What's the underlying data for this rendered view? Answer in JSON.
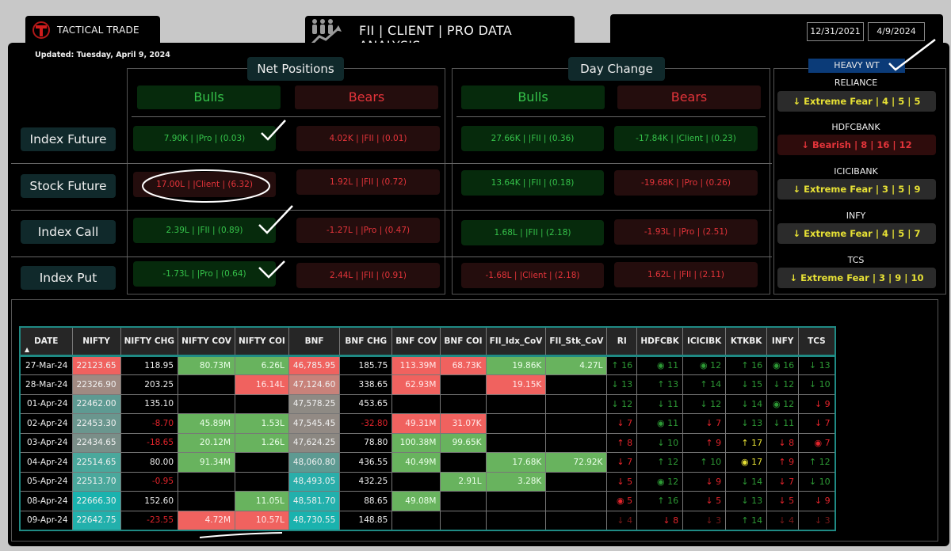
{
  "app": {
    "brand": "TACTICAL TRADE",
    "title": "FII | CLIENT | PRO DATA ANALYSIS",
    "updated": "Updated: Tuesday, April 9, 2024",
    "date_range": {
      "start": "12/31/2021",
      "end": "4/9/2024"
    }
  },
  "net_positions": {
    "title": "Net Positions",
    "bulls_label": "Bulls",
    "bears_label": "Bears",
    "rows": [
      {
        "label": "Index Future",
        "bull": "7.90K | |Pro | (0.03)",
        "bear": "4.02K | |FII | (0.01)",
        "bull_tone": "green",
        "bear_tone": "red"
      },
      {
        "label": "Stock Future",
        "bull": "17.00L | |Client | (6.32)",
        "bear": "1.92L | |FII | (0.72)",
        "bull_tone": "red",
        "bear_tone": "red"
      },
      {
        "label": "Index Call",
        "bull": "2.39L | |FII | (0.89)",
        "bear": "-1.27L | |Pro | (0.47)",
        "bull_tone": "green",
        "bear_tone": "red"
      },
      {
        "label": "Index Put",
        "bull": "-1.73L | |Pro | (0.64)",
        "bear": "2.44L | |FII | (0.91)",
        "bull_tone": "green",
        "bear_tone": "red"
      }
    ]
  },
  "day_change": {
    "title": "Day Change",
    "bulls_label": "Bulls",
    "bears_label": "Bears",
    "rows": [
      {
        "bull": "27.66K | |FII | (0.36)",
        "bear": "-17.84K | |Client | (0.23)",
        "bull_tone": "green",
        "bear_tone": "green"
      },
      {
        "bull": "13.64K | |FII | (0.18)",
        "bear": "-19.68K | |Pro | (0.26)",
        "bull_tone": "green",
        "bear_tone": "red"
      },
      {
        "bull": "1.68L | |FII | (2.18)",
        "bear": "-1.93L | |Pro | (2.51)",
        "bull_tone": "green",
        "bear_tone": "red"
      },
      {
        "bull": "-1.68L | |Client | (2.18)",
        "bear": "1.62L | |FII | (2.11)",
        "bull_tone": "red",
        "bear_tone": "red"
      }
    ]
  },
  "heavy_wt": {
    "title": "HEAVY WT",
    "items": [
      {
        "name": "RELIANCE",
        "value": "↓ Extreme Fear | 4 | 5 | 5",
        "tone": "fear"
      },
      {
        "name": "HDFCBANK",
        "value": "↓ Bearish | 8 | 16 | 12",
        "tone": "bear"
      },
      {
        "name": "ICICIBANK",
        "value": "↓ Extreme Fear | 3 | 5 | 9",
        "tone": "fear"
      },
      {
        "name": "INFY",
        "value": "↓ Extreme Fear | 4 | 5 | 7",
        "tone": "fear"
      },
      {
        "name": "TCS",
        "value": "↓ Extreme Fear | 3 | 9 | 10",
        "tone": "fear"
      }
    ]
  },
  "table": {
    "sort_indicator": "▲",
    "columns": [
      "DATE",
      "NIFTY",
      "NIFTY CHG",
      "NIFTY COV",
      "NIFTY COI",
      "BNF",
      "BNF CHG",
      "BNF COV",
      "BNF COI",
      "FII_Idx_CoV",
      "FII_Stk_CoV",
      "RI",
      "HDFCBK",
      "ICICIBK",
      "KTKBK",
      "INFY",
      "TCS"
    ],
    "rows": [
      {
        "date": "27-Mar-24",
        "nifty": "22123.65",
        "nifty_bg": "#f0625f",
        "nifty_chg": "118.95",
        "nifty_cov": "80.73M",
        "nifty_cov_t": "g",
        "nifty_coi": "6.26L",
        "nifty_coi_t": "g",
        "bnf": "46,785.95",
        "bnf_bg": "#f0625f",
        "bnf_chg": "185.75",
        "bnf_cov": "113.39M",
        "bnf_cov_t": "r",
        "bnf_coi": "68.73K",
        "bnf_coi_t": "r",
        "fii_idx": "19.86K",
        "fii_idx_t": "g",
        "fii_stk": "4.27L",
        "fii_stk_t": "g",
        "signals": [
          [
            "↑ 16",
            "g"
          ],
          [
            "◉ 11",
            "g"
          ],
          [
            "◉ 12",
            "g"
          ],
          [
            "↑ 16",
            "g"
          ],
          [
            "◉ 16",
            "g"
          ],
          [
            "↓ 13",
            "g"
          ]
        ]
      },
      {
        "date": "28-Mar-24",
        "nifty": "22326.90",
        "nifty_bg": "#a08a82",
        "nifty_chg": "203.25",
        "nifty_cov": "",
        "nifty_cov_t": "",
        "nifty_coi": "16.14L",
        "nifty_coi_t": "r",
        "bnf": "47,124.60",
        "bnf_bg": "#c8827a",
        "bnf_chg": "338.65",
        "bnf_cov": "62.93M",
        "bnf_cov_t": "r",
        "bnf_coi": "",
        "bnf_coi_t": "",
        "fii_idx": "19.15K",
        "fii_idx_t": "r",
        "fii_stk": "",
        "fii_stk_t": "",
        "signals": [
          [
            "↓ 13",
            "g"
          ],
          [
            "↑ 13",
            "g"
          ],
          [
            "↑ 14",
            "g"
          ],
          [
            "↓ 15",
            "g"
          ],
          [
            "↓ 12",
            "g"
          ],
          [
            "↓ 10",
            "g"
          ]
        ]
      },
      {
        "date": "01-Apr-24",
        "nifty": "22462.00",
        "nifty_bg": "#5e9a92",
        "nifty_chg": "135.10",
        "nifty_cov": "",
        "nifty_cov_t": "",
        "nifty_coi": "",
        "nifty_coi_t": "",
        "bnf": "47,578.25",
        "bnf_bg": "#8e8a84",
        "bnf_chg": "453.65",
        "bnf_cov": "",
        "bnf_cov_t": "",
        "bnf_coi": "",
        "bnf_coi_t": "",
        "fii_idx": "",
        "fii_idx_t": "",
        "fii_stk": "",
        "fii_stk_t": "",
        "signals": [
          [
            "↓ 12",
            "g"
          ],
          [
            "↓ 11",
            "g"
          ],
          [
            "↓ 12",
            "g"
          ],
          [
            "↓ 14",
            "g"
          ],
          [
            "◉ 12",
            "g"
          ],
          [
            "↓ 9",
            "r"
          ]
        ]
      },
      {
        "date": "02-Apr-24",
        "nifty": "22453.30",
        "nifty_bg": "#6a968e",
        "nifty_chg": "-8.70",
        "nifty_cov": "45.89M",
        "nifty_cov_t": "g",
        "nifty_coi": "1.53L",
        "nifty_coi_t": "g",
        "bnf": "47,545.45",
        "bnf_bg": "#928a84",
        "bnf_chg": "-32.80",
        "bnf_cov": "49.31M",
        "bnf_cov_t": "r",
        "bnf_coi": "31.07K",
        "bnf_coi_t": "r",
        "fii_idx": "",
        "fii_idx_t": "",
        "fii_stk": "",
        "fii_stk_t": "",
        "signals": [
          [
            "↓ 7",
            "r"
          ],
          [
            "◉ 11",
            "g"
          ],
          [
            "↓ 7",
            "r"
          ],
          [
            "↓ 13",
            "g"
          ],
          [
            "↓ 11",
            "g"
          ],
          [
            "↓ 7",
            "r"
          ]
        ]
      },
      {
        "date": "03-Apr-24",
        "nifty": "22434.65",
        "nifty_bg": "#7a8e88",
        "nifty_chg": "-18.65",
        "nifty_cov": "20.12M",
        "nifty_cov_t": "g",
        "nifty_coi": "1.26L",
        "nifty_coi_t": "g",
        "bnf": "47,624.25",
        "bnf_bg": "#8c8882",
        "bnf_chg": "78.80",
        "bnf_cov": "100.38M",
        "bnf_cov_t": "g",
        "bnf_coi": "99.65K",
        "bnf_coi_t": "g",
        "fii_idx": "",
        "fii_idx_t": "",
        "fii_stk": "",
        "fii_stk_t": "",
        "signals": [
          [
            "↑ 8",
            "r"
          ],
          [
            "↓ 10",
            "g"
          ],
          [
            "↑ 9",
            "r"
          ],
          [
            "↑ 17",
            "y"
          ],
          [
            "↓ 8",
            "r"
          ],
          [
            "◉ 7",
            "r"
          ]
        ]
      },
      {
        "date": "04-Apr-24",
        "nifty": "22514.65",
        "nifty_bg": "#4aa89c",
        "nifty_chg": "80.00",
        "nifty_cov": "91.34M",
        "nifty_cov_t": "g",
        "nifty_coi": "",
        "nifty_coi_t": "",
        "bnf": "48,060.80",
        "bnf_bg": "#5e9a92",
        "bnf_chg": "436.55",
        "bnf_cov": "40.49M",
        "bnf_cov_t": "g",
        "bnf_coi": "",
        "bnf_coi_t": "",
        "fii_idx": "17.68K",
        "fii_idx_t": "g",
        "fii_stk": "72.92K",
        "fii_stk_t": "g",
        "signals": [
          [
            "↓ 7",
            "r"
          ],
          [
            "↑ 12",
            "g"
          ],
          [
            "↑ 10",
            "g"
          ],
          [
            "◉ 17",
            "y"
          ],
          [
            "↑ 9",
            "r"
          ],
          [
            "↑ 12",
            "g"
          ]
        ]
      },
      {
        "date": "05-Apr-24",
        "nifty": "22513.70",
        "nifty_bg": "#4aa89c",
        "nifty_chg": "-0.95",
        "nifty_cov": "",
        "nifty_cov_t": "",
        "nifty_coi": "",
        "nifty_coi_t": "",
        "bnf": "48,493.05",
        "bnf_bg": "#2aaeaa",
        "bnf_chg": "432.25",
        "bnf_cov": "",
        "bnf_cov_t": "",
        "bnf_coi": "2.91L",
        "bnf_coi_t": "g",
        "fii_idx": "3.28K",
        "fii_idx_t": "g",
        "fii_stk": "",
        "fii_stk_t": "",
        "signals": [
          [
            "↓ 5",
            "r"
          ],
          [
            "◉ 12",
            "g"
          ],
          [
            "↓ 9",
            "r"
          ],
          [
            "↓ 14",
            "g"
          ],
          [
            "↓ 7",
            "r"
          ],
          [
            "↓ 10",
            "g"
          ]
        ]
      },
      {
        "date": "08-Apr-24",
        "nifty": "22666.30",
        "nifty_bg": "#1ab2ae",
        "nifty_chg": "152.60",
        "nifty_cov": "",
        "nifty_cov_t": "",
        "nifty_coi": "11.05L",
        "nifty_coi_t": "g",
        "bnf": "48,581.70",
        "bnf_bg": "#22b0ac",
        "bnf_chg": "88.65",
        "bnf_cov": "49.08M",
        "bnf_cov_t": "g",
        "bnf_coi": "",
        "bnf_coi_t": "",
        "fii_idx": "",
        "fii_idx_t": "",
        "fii_stk": "",
        "fii_stk_t": "",
        "signals": [
          [
            "◉ 5",
            "r"
          ],
          [
            "↑ 16",
            "g"
          ],
          [
            "↓ 5",
            "r"
          ],
          [
            "↓ 13",
            "g"
          ],
          [
            "↓ 5",
            "r"
          ],
          [
            "↓ 9",
            "r"
          ]
        ]
      },
      {
        "date": "09-Apr-24",
        "nifty": "22642.75",
        "nifty_bg": "#22b0ac",
        "nifty_chg": "-23.55",
        "nifty_cov": "4.72M",
        "nifty_cov_t": "r",
        "nifty_coi": "10.57L",
        "nifty_coi_t": "r",
        "bnf": "48,730.55",
        "bnf_bg": "#1ab2ae",
        "bnf_chg": "148.85",
        "bnf_cov": "",
        "bnf_cov_t": "",
        "bnf_coi": "",
        "bnf_coi_t": "",
        "fii_idx": "",
        "fii_idx_t": "",
        "fii_stk": "",
        "fii_stk_t": "",
        "signals": [
          [
            "↓ 4",
            "dr"
          ],
          [
            "↓ 8",
            "r"
          ],
          [
            "↓ 3",
            "dr"
          ],
          [
            "↑ 14",
            "g"
          ],
          [
            "↓ 4",
            "dr"
          ],
          [
            "↓ 3",
            "dr"
          ]
        ]
      }
    ]
  }
}
